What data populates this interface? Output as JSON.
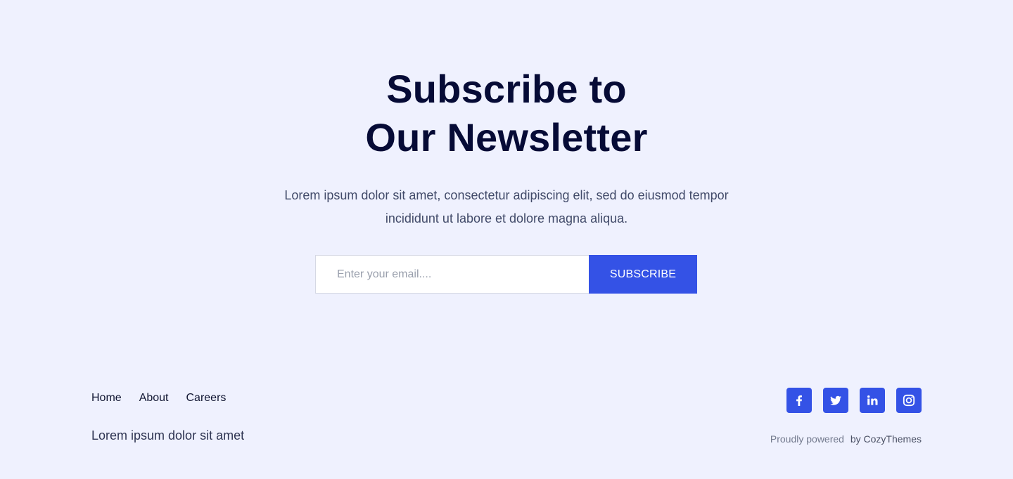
{
  "hero": {
    "title_line1": "Subscribe to",
    "title_line2": "Our Newsletter",
    "description": "Lorem ipsum dolor sit amet, consectetur adipiscing elit, sed do eiusmod tempor incididunt ut labore et dolore magna aliqua."
  },
  "form": {
    "email_placeholder": "Enter your email....",
    "email_value": "",
    "subscribe_label": "SUBSCRIBE"
  },
  "footer": {
    "nav": [
      {
        "label": "Home"
      },
      {
        "label": "About"
      },
      {
        "label": "Careers"
      }
    ],
    "tagline": "Lorem ipsum dolor sit amet",
    "social": [
      {
        "icon": "facebook-icon"
      },
      {
        "icon": "twitter-icon"
      },
      {
        "icon": "linkedin-icon"
      },
      {
        "icon": "instagram-icon"
      }
    ],
    "credit_prefix": "Proudly powered",
    "credit_brand": "by CozyThemes"
  },
  "colors": {
    "background": "#eff1fe",
    "heading": "#060b36",
    "accent": "#3452e6"
  }
}
